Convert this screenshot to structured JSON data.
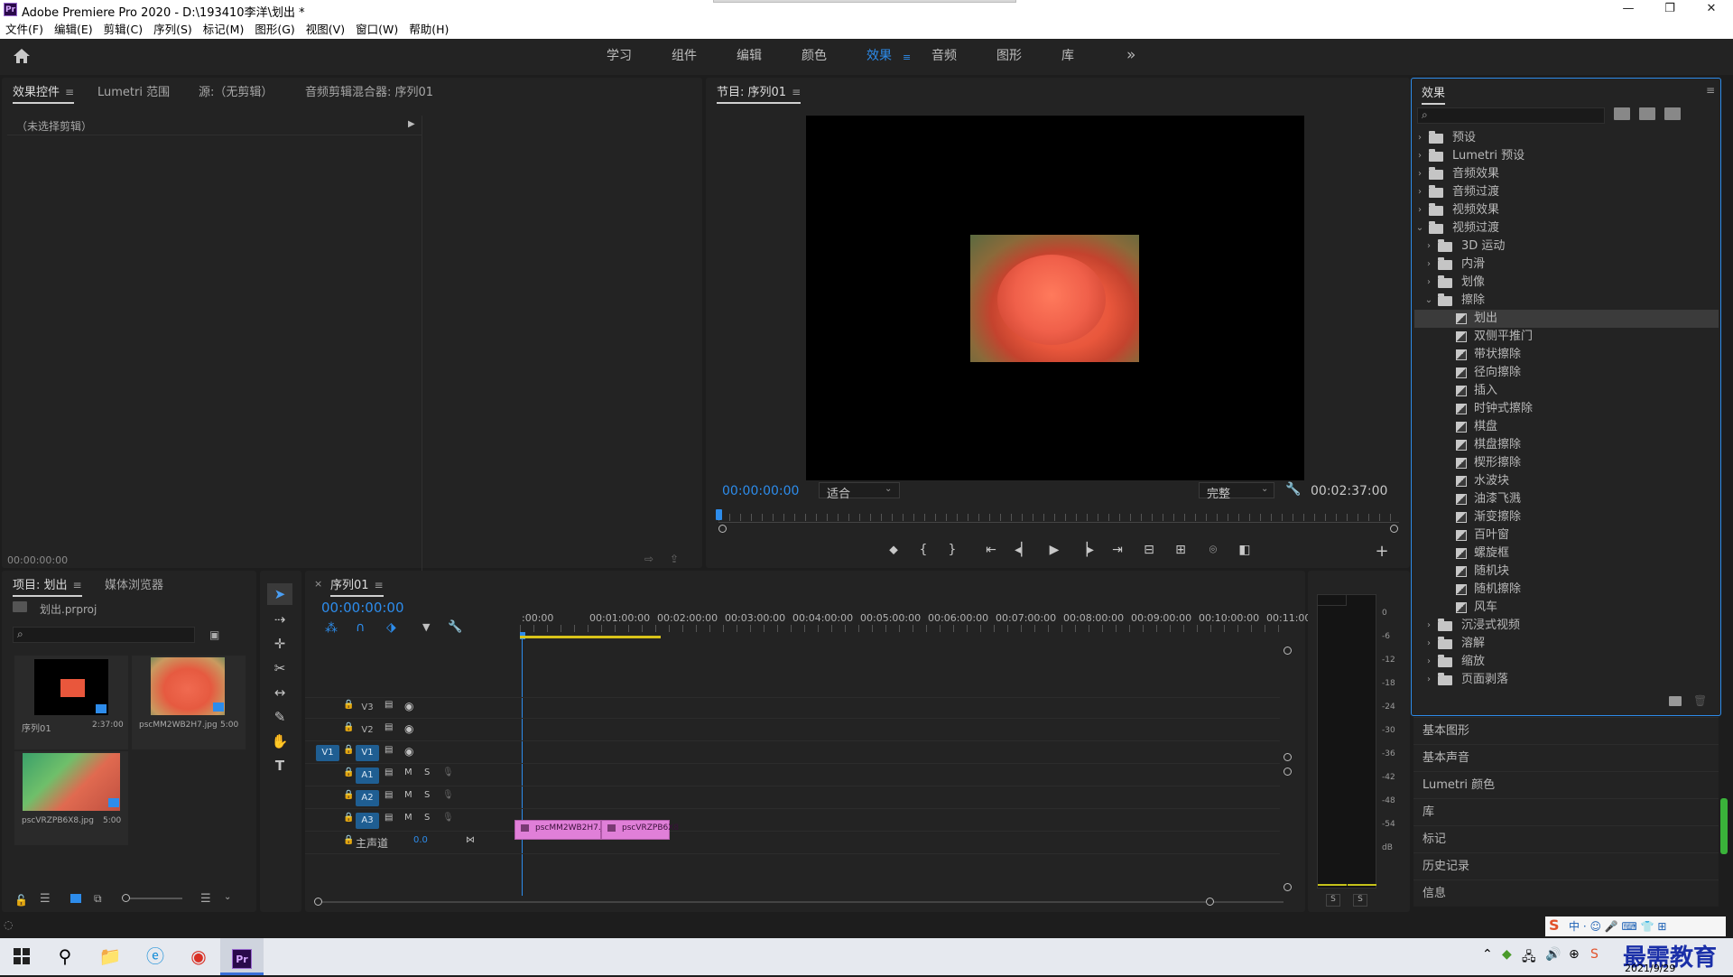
{
  "window": {
    "title": "Adobe Premiere Pro 2020 - D:\\193410李洋\\划出 *",
    "app_icon": "Pr",
    "minimize": "—",
    "maximize": "❐",
    "close": "✕"
  },
  "menu": [
    "文件(F)",
    "编辑(E)",
    "剪辑(C)",
    "序列(S)",
    "标记(M)",
    "图形(G)",
    "视图(V)",
    "窗口(W)",
    "帮助(H)"
  ],
  "workspaces": {
    "tabs": [
      "学习",
      "组件",
      "编辑",
      "颜色",
      "效果",
      "音频",
      "图形",
      "库"
    ],
    "active": "效果",
    "more": "»"
  },
  "source_panel": {
    "tabs": [
      "效果控件",
      "Lumetri 范围",
      "源:（无剪辑）",
      "音频剪辑混合器: 序列01"
    ],
    "no_clip": "（未选择剪辑）",
    "timecode": "00:00:00:00"
  },
  "program_monitor": {
    "title": "节目: 序列01",
    "timecode_current": "00:00:00:00",
    "fit": "适合",
    "quality": "完整",
    "timecode_duration": "00:02:37:00"
  },
  "project_panel": {
    "tabs": [
      "项目: 划出",
      "媒体浏览器"
    ],
    "project_file": "划出.prproj",
    "items": [
      {
        "name": "序列01",
        "duration": "2:37:00"
      },
      {
        "name": "pscMM2WB2H7.jpg",
        "duration": "5:00"
      },
      {
        "name": "pscVRZPB6X8.jpg",
        "duration": "5:00"
      }
    ]
  },
  "timeline": {
    "tab": "序列01",
    "timecode": "00:00:00:00",
    "ruler": [
      ":00:00",
      "00:01:00:00",
      "00:02:00:00",
      "00:03:00:00",
      "00:04:00:00",
      "00:05:00:00",
      "00:06:00:00",
      "00:07:00:00",
      "00:08:00:00",
      "00:09:00:00",
      "00:10:00:00",
      "00:11:00:"
    ],
    "video_tracks": [
      "V3",
      "V2",
      "V1"
    ],
    "audio_tracks": [
      "A1",
      "A2",
      "A3"
    ],
    "source_patch": "V1",
    "master": {
      "label": "主声道",
      "value": "0.0"
    },
    "clips": [
      {
        "name": "pscMM2WB2H7.jp"
      },
      {
        "name": "pscVRZPB6X8"
      }
    ],
    "audio_buttons": {
      "m": "M",
      "s": "S"
    }
  },
  "audio_meter": {
    "scale": [
      "0",
      "-6",
      "-12",
      "-18",
      "-24",
      "-30",
      "-36",
      "-42",
      "-48",
      "-54",
      "dB"
    ],
    "solo": [
      "S",
      "S"
    ]
  },
  "effects_panel": {
    "title": "效果",
    "tree": [
      {
        "label": "预设",
        "level": 0,
        "type": "folder",
        "expanded": false
      },
      {
        "label": "Lumetri 预设",
        "level": 0,
        "type": "folder",
        "expanded": false
      },
      {
        "label": "音频效果",
        "level": 0,
        "type": "folder",
        "expanded": false
      },
      {
        "label": "音频过渡",
        "level": 0,
        "type": "folder",
        "expanded": false
      },
      {
        "label": "视频效果",
        "level": 0,
        "type": "folder",
        "expanded": false
      },
      {
        "label": "视频过渡",
        "level": 0,
        "type": "folder",
        "expanded": true
      },
      {
        "label": "3D 运动",
        "level": 1,
        "type": "folder",
        "expanded": false
      },
      {
        "label": "内滑",
        "level": 1,
        "type": "folder",
        "expanded": false
      },
      {
        "label": "划像",
        "level": 1,
        "type": "folder",
        "expanded": false
      },
      {
        "label": "擦除",
        "level": 1,
        "type": "folder",
        "expanded": true
      },
      {
        "label": "划出",
        "level": 2,
        "type": "effect",
        "selected": true
      },
      {
        "label": "双侧平推门",
        "level": 2,
        "type": "effect"
      },
      {
        "label": "带状擦除",
        "level": 2,
        "type": "effect"
      },
      {
        "label": "径向擦除",
        "level": 2,
        "type": "effect"
      },
      {
        "label": "插入",
        "level": 2,
        "type": "effect"
      },
      {
        "label": "时钟式擦除",
        "level": 2,
        "type": "effect"
      },
      {
        "label": "棋盘",
        "level": 2,
        "type": "effect"
      },
      {
        "label": "棋盘擦除",
        "level": 2,
        "type": "effect"
      },
      {
        "label": "楔形擦除",
        "level": 2,
        "type": "effect"
      },
      {
        "label": "水波块",
        "level": 2,
        "type": "effect"
      },
      {
        "label": "油漆飞溅",
        "level": 2,
        "type": "effect"
      },
      {
        "label": "渐变擦除",
        "level": 2,
        "type": "effect"
      },
      {
        "label": "百叶窗",
        "level": 2,
        "type": "effect"
      },
      {
        "label": "螺旋框",
        "level": 2,
        "type": "effect"
      },
      {
        "label": "随机块",
        "level": 2,
        "type": "effect"
      },
      {
        "label": "随机擦除",
        "level": 2,
        "type": "effect"
      },
      {
        "label": "风车",
        "level": 2,
        "type": "effect"
      },
      {
        "label": "沉浸式视频",
        "level": 1,
        "type": "folder",
        "expanded": false
      },
      {
        "label": "溶解",
        "level": 1,
        "type": "folder",
        "expanded": false
      },
      {
        "label": "缩放",
        "level": 1,
        "type": "folder",
        "expanded": false
      },
      {
        "label": "页面剥落",
        "level": 1,
        "type": "folder",
        "expanded": false
      }
    ]
  },
  "side_panels": [
    "基本图形",
    "基本声音",
    "Lumetri 颜色",
    "库",
    "标记",
    "历史记录",
    "信息"
  ],
  "taskbar": {
    "date": "2021/9/29",
    "watermark": "最需教育"
  },
  "colors": {
    "accent": "#2d8ceb",
    "clip": "#e07fd8",
    "track_select": "#1f5e92",
    "playhead": "#2d8ceb"
  }
}
